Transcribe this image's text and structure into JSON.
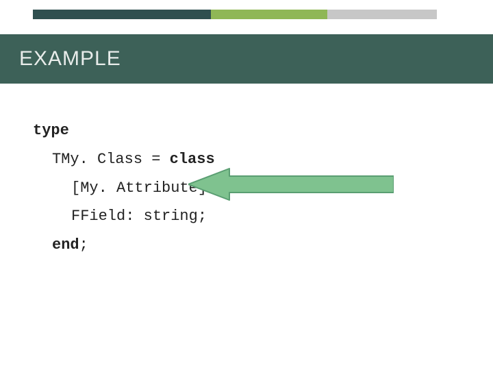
{
  "colors": {
    "band": "#3d6158",
    "stripe_dark": "#2f4f4f",
    "stripe_green": "#8fb756",
    "stripe_grey": "#c7c7c7",
    "arrow_fill": "#7fc28f",
    "arrow_stroke": "#5a9e72"
  },
  "header": {
    "title": "EXAMPLE"
  },
  "code": {
    "kw_type": "type",
    "line_class_decl_pre": "TMy. Class = ",
    "kw_class": "class",
    "line_attr": "[My. Attribute]",
    "line_field": "FField: string;",
    "kw_end": "end",
    "semi": ";"
  }
}
